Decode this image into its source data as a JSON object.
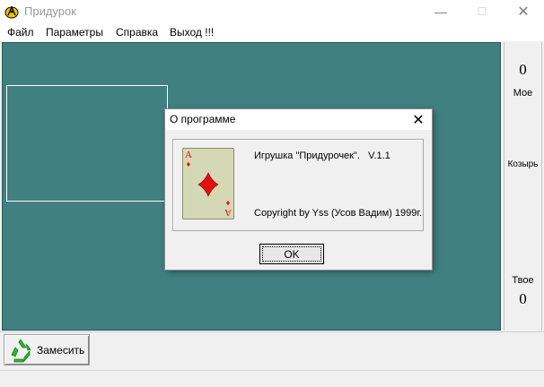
{
  "window": {
    "title": "Придурок",
    "icon": "cards-app-icon",
    "minimize_glyph": "—",
    "maximize_glyph": "☐",
    "close_glyph": "✕"
  },
  "menu": {
    "items": [
      "Файл",
      "Параметры",
      "Справка",
      "Выход !!!"
    ]
  },
  "side_panel": {
    "my_score": "0",
    "my_label": "Мое",
    "trump_label": "Козырь",
    "your_label": "Твое",
    "your_score": "0"
  },
  "toolbar": {
    "shuffle_label": "Замесить",
    "shuffle_icon": "recycle-icon"
  },
  "dialog": {
    "title": "О программе",
    "close_glyph": "✕",
    "line1": "Игрушка \"Придурочек\".   V.1.1",
    "line2": "Copyright by Yss (Усов Вадим) 1999г.",
    "ok_label": "OK",
    "card": {
      "rank": "A",
      "suit": "♦",
      "suit_name": "diamond-icon"
    }
  },
  "colors": {
    "table_felt": "#408080",
    "card_face": "#d4d8b4",
    "suit_red": "#e01010"
  }
}
